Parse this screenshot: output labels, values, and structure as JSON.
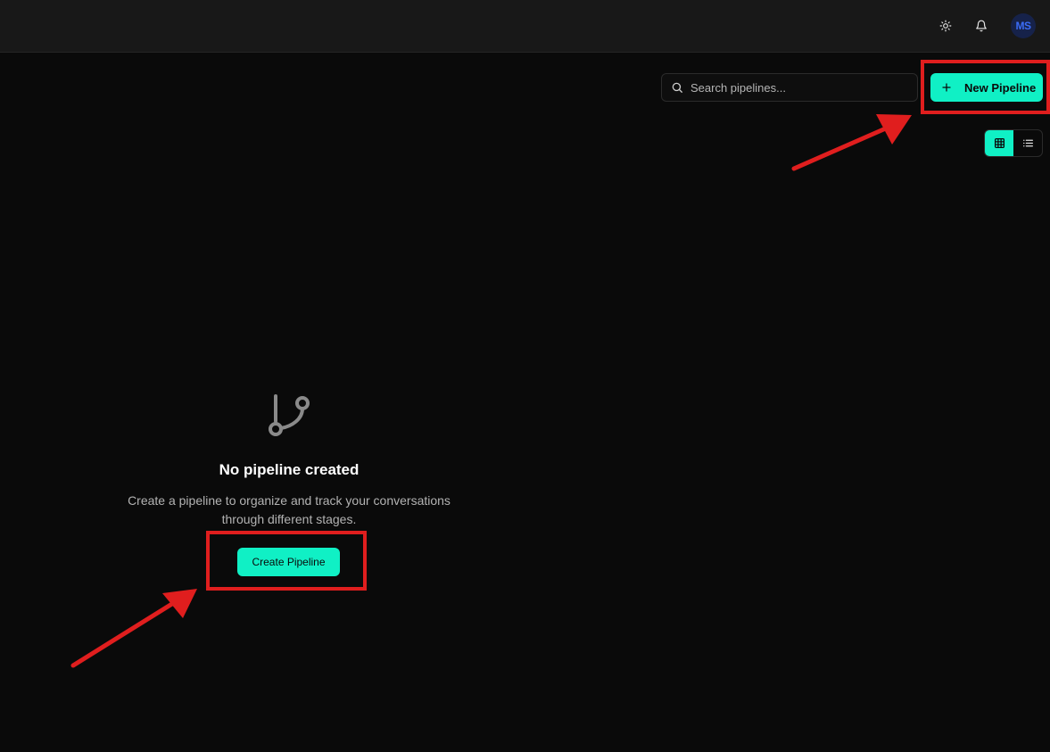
{
  "topbar": {
    "theme_icon": "sun-icon",
    "notification_icon": "bell-icon",
    "avatar_initials": "MS"
  },
  "toolbar": {
    "search_placeholder": "Search pipelines...",
    "search_value": "",
    "search_icon": "search-icon",
    "new_pipeline_label": "New Pipeline",
    "new_pipeline_icon": "plus-icon",
    "view_modes": [
      {
        "name": "grid",
        "icon": "grid-icon",
        "active": true
      },
      {
        "name": "list",
        "icon": "list-icon",
        "active": false
      }
    ]
  },
  "empty_state": {
    "icon": "git-branch-icon",
    "title": "No pipeline created",
    "description_line1": "Create a pipeline to organize and track your conversations",
    "description_line2": "through different stages.",
    "create_label": "Create Pipeline"
  },
  "colors": {
    "accent": "#10f0c5",
    "background": "#0a0a0a",
    "topbar": "#181818",
    "annotation": "#e01e1e",
    "avatar_bg": "#16224a",
    "avatar_text": "#3b6cf6"
  }
}
